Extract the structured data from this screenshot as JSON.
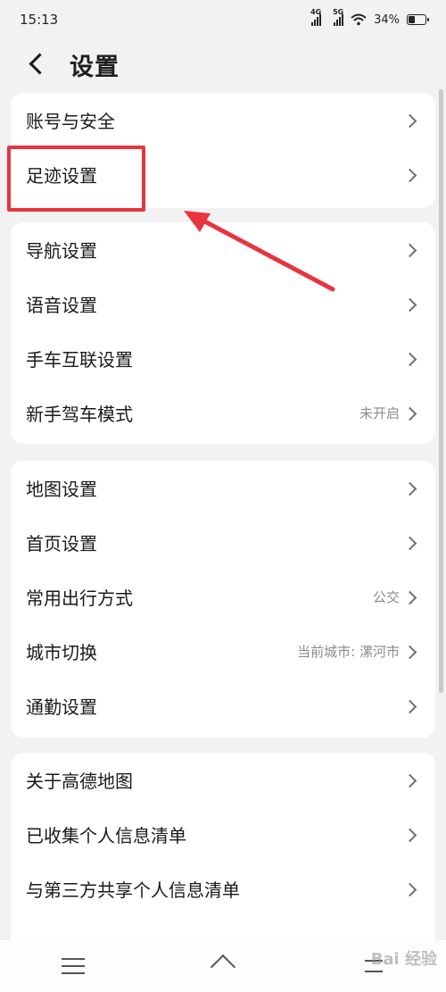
{
  "status": {
    "time": "15:13",
    "net1": "4G",
    "net2": "5G",
    "battery": "34%"
  },
  "header": {
    "title": "设置"
  },
  "groups": [
    {
      "items": [
        {
          "label": "账号与安全",
          "value": ""
        },
        {
          "label": "足迹设置",
          "value": ""
        }
      ]
    },
    {
      "items": [
        {
          "label": "导航设置",
          "value": ""
        },
        {
          "label": "语音设置",
          "value": ""
        },
        {
          "label": "手车互联设置",
          "value": ""
        },
        {
          "label": "新手驾车模式",
          "value": "未开启"
        }
      ]
    },
    {
      "items": [
        {
          "label": "地图设置",
          "value": ""
        },
        {
          "label": "首页设置",
          "value": ""
        },
        {
          "label": "常用出行方式",
          "value": "公交"
        },
        {
          "label": "城市切换",
          "value": "当前城市: 漯河市"
        },
        {
          "label": "通勤设置",
          "value": ""
        }
      ]
    },
    {
      "items": [
        {
          "label": "关于高德地图",
          "value": ""
        },
        {
          "label": "已收集个人信息清单",
          "value": ""
        },
        {
          "label": "与第三方共享个人信息清单",
          "value": ""
        }
      ]
    }
  ],
  "colors": {
    "highlight": "#e8343c",
    "background": "#f2f2f5"
  },
  "watermark": "Bai 经验"
}
